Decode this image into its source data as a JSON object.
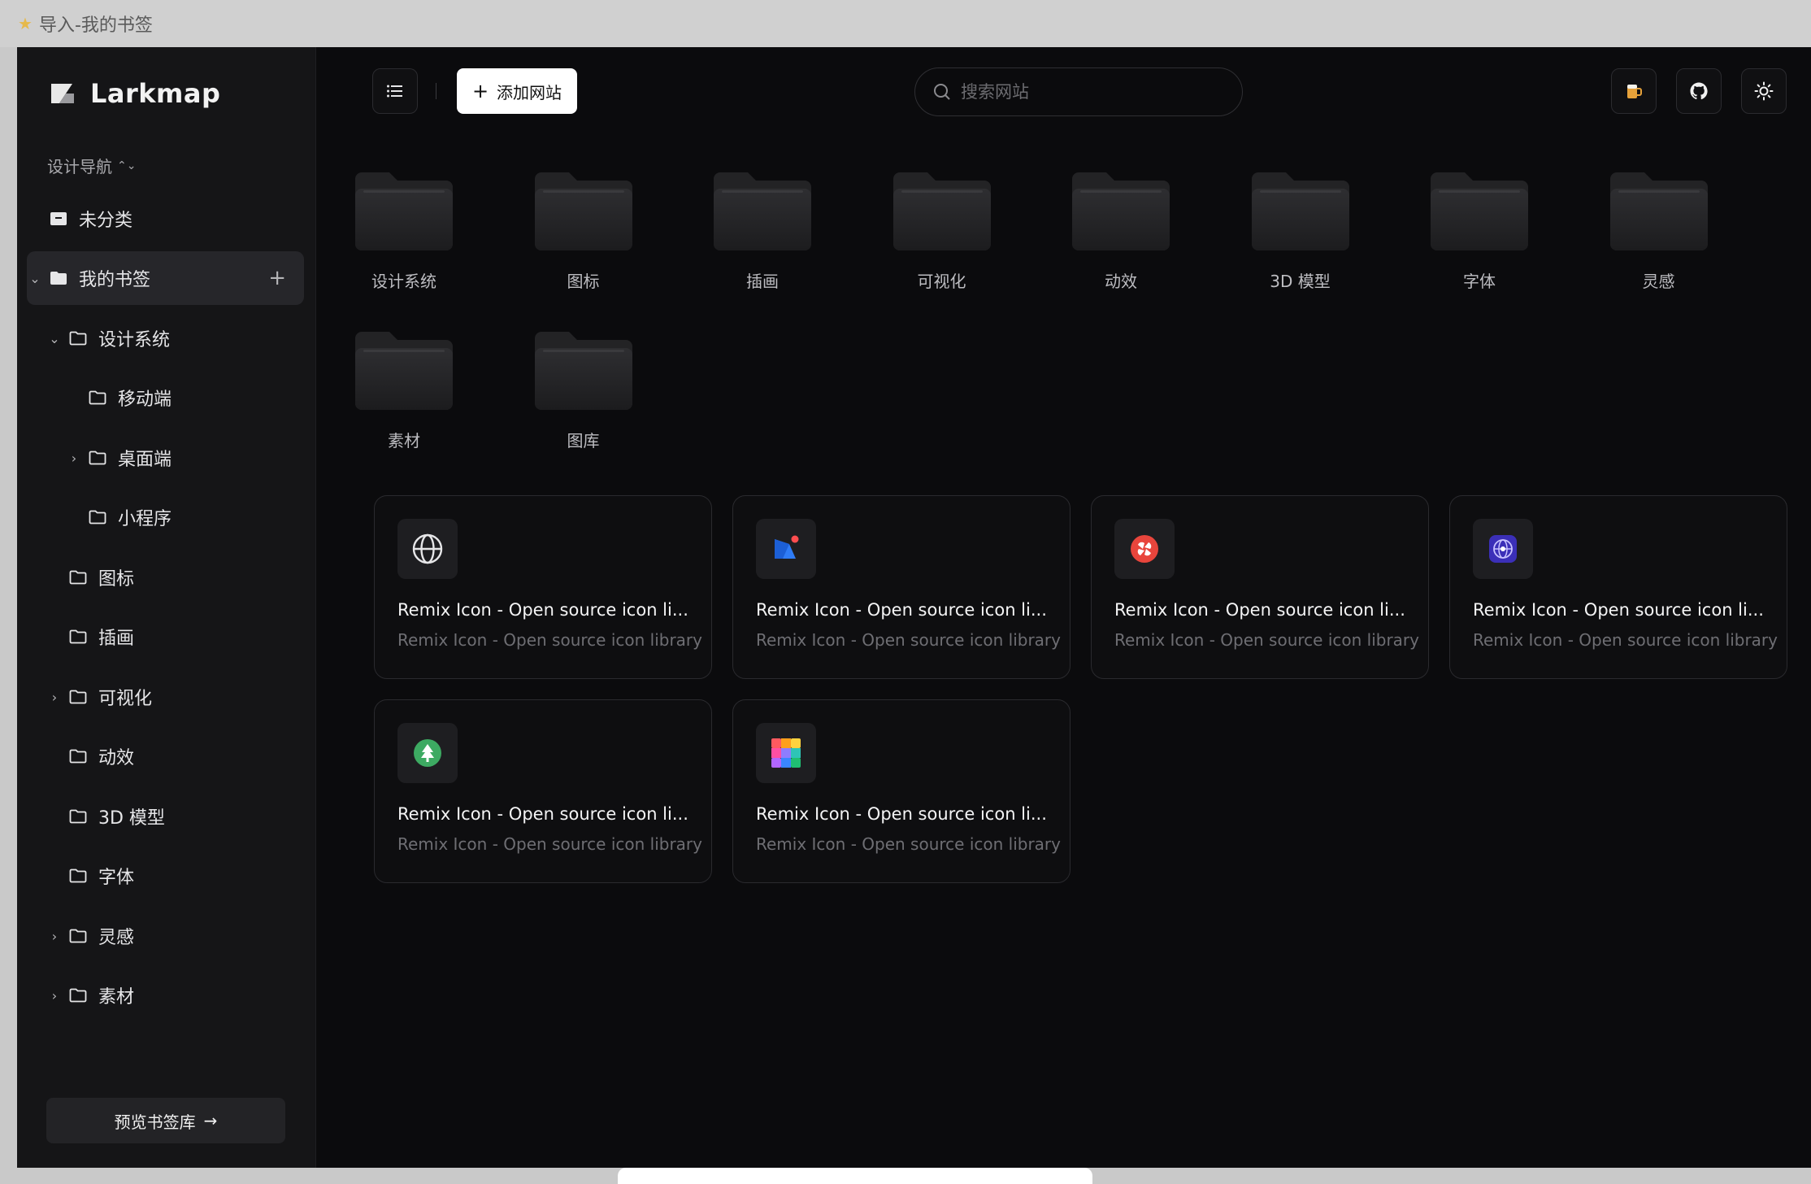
{
  "window": {
    "title": "导入-我的书签"
  },
  "brand": {
    "name": "Larkmap"
  },
  "sidebar": {
    "nav_switch": "设计导航",
    "uncategorized": "未分类",
    "items": [
      {
        "label": "我的书签",
        "active": true
      },
      {
        "label": "设计系统"
      },
      {
        "label": "移动端"
      },
      {
        "label": "桌面端"
      },
      {
        "label": "小程序"
      },
      {
        "label": "图标"
      },
      {
        "label": "插画"
      },
      {
        "label": "可视化"
      },
      {
        "label": "动效"
      },
      {
        "label": "3D 模型"
      },
      {
        "label": "字体"
      },
      {
        "label": "灵感"
      },
      {
        "label": "素材"
      }
    ],
    "preview_button": "预览书签库"
  },
  "toolbar": {
    "add_label": "添加网站",
    "search_placeholder": "搜索网站"
  },
  "folders": [
    "设计系统",
    "图标",
    "插画",
    "可视化",
    "动效",
    "3D 模型",
    "字体",
    "灵感",
    "素材",
    "图库"
  ],
  "cards": [
    {
      "icon": "globe-icon",
      "title": "Remix Icon - Open source icon li...",
      "desc": "Remix Icon - Open source icon library"
    },
    {
      "icon": "blue-app-icon",
      "title": "Remix Icon - Open source icon li...",
      "desc": "Remix Icon - Open source icon library"
    },
    {
      "icon": "red-logo-icon",
      "title": "Remix Icon - Open source icon li...",
      "desc": "Remix Icon - Open source icon library"
    },
    {
      "icon": "purple-globe-icon",
      "title": "Remix Icon - Open source icon li...",
      "desc": "Remix Icon - Open source icon library"
    },
    {
      "icon": "green-tree-icon",
      "title": "Remix Icon - Open source icon li...",
      "desc": "Remix Icon - Open source icon library"
    },
    {
      "icon": "color-grid-icon",
      "title": "Remix Icon - Open source icon li...",
      "desc": "Remix Icon - Open source icon library"
    }
  ],
  "colors": {
    "background": "#0b0b0d",
    "sidebar": "#151517",
    "accent": "#ffffff"
  }
}
